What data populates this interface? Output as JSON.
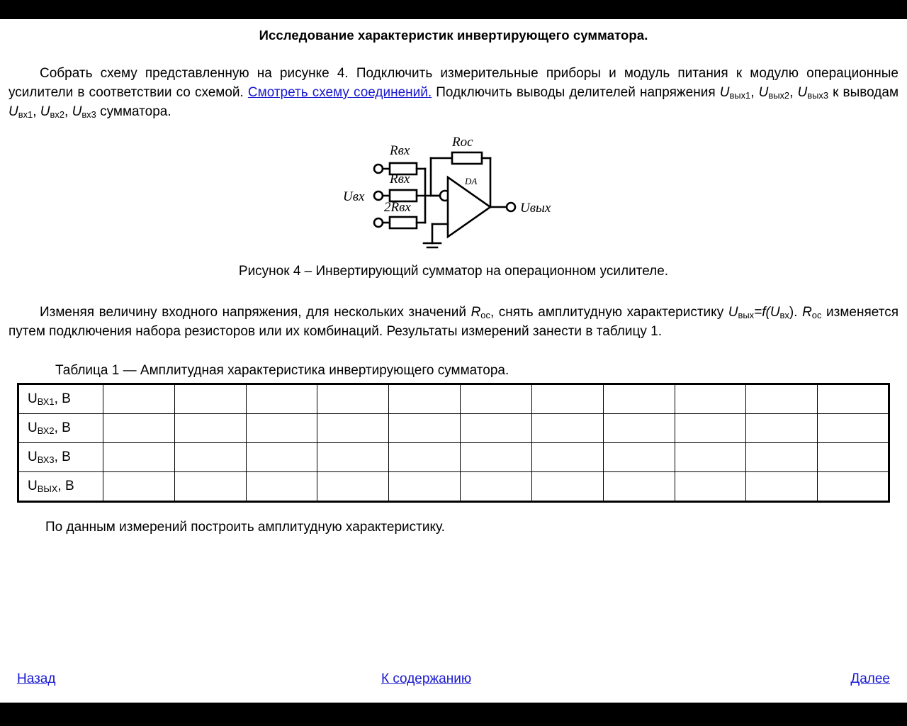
{
  "page": {
    "title": "Исследование характеристик инвертирующего сумматора."
  },
  "intro": {
    "part1": "Собрать схему представленную на рисунке 4. Подключить измерительные приборы и модуль питания к модулю операционные усилители в соответствии со схемой. ",
    "link": "Смотреть схему соединений.",
    "part2": " Подключить выводы делителей напряжения ",
    "u_out_1": "U",
    "u_out_1_sub": "вых1",
    "u_out_2": "U",
    "u_out_2_sub": "вых2",
    "u_out_3": "U",
    "u_out_3_sub": "вых3",
    "mid": " к выводам ",
    "u_in_1": "U",
    "u_in_1_sub": "вх1",
    "u_in_2": "U",
    "u_in_2_sub": "вх2",
    "u_in_3": "U",
    "u_in_3_sub": "вх3",
    "tail": " сумматора."
  },
  "figure": {
    "caption": "Рисунок 4 – Инвертирующий сумматор на операционном усилителе.",
    "labels": {
      "r_in_1": "Rвх",
      "r_in_2": "Rвх",
      "r_in_3": "2Rвх",
      "r_fb": "Rос",
      "opamp": "DA",
      "u_in": "Uвх",
      "u_out": "Uвых"
    }
  },
  "task": {
    "p1_a": "Изменяя величину входного напряжения, для нескольких значений ",
    "p1_r": "R",
    "p1_r_sub": "ос",
    "p1_b": ", снять амплитудную характеристику ",
    "p1_u_out": "U",
    "p1_u_out_sub": "вых",
    "p1_eq": "=f(",
    "p1_u_in": "U",
    "p1_u_in_sub": "вх",
    "p1_c": ").",
    "p2_r": "R",
    "p2_r_sub": "ос",
    "p2_a": " изменяется  путем подключения набора резисторов или их комбинаций. Результаты измерений занести в таблицу 1."
  },
  "table": {
    "caption": "Таблица 1 —  Амплитудная характеристика инвертирующего сумматора.",
    "column_count": 11,
    "rows": [
      {
        "symbol": "U",
        "subscript": "ВХ1",
        "unit": ", В"
      },
      {
        "symbol": "U",
        "subscript": "ВХ2",
        "unit": ", В"
      },
      {
        "symbol": "U",
        "subscript": "ВХ3",
        "unit": ", В"
      },
      {
        "symbol": "U",
        "subscript": "ВЫХ",
        "unit": ", В"
      }
    ]
  },
  "closing": "По данным измерений  построить амплитудную характеристику.",
  "nav": {
    "back": "Назад",
    "toc": "К содержанию",
    "next": "Далее"
  },
  "colors": {
    "link": "#1818d0",
    "text": "#000000",
    "bar": "#000000",
    "background": "#ffffff"
  }
}
